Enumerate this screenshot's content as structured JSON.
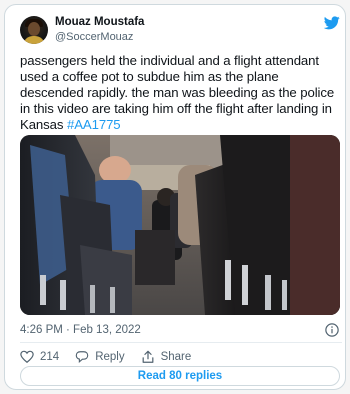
{
  "tweet": {
    "display_name": "Mouaz Moustafa",
    "handle": "@SoccerMouaz",
    "text_main": "passengers held the individual and a flight attendant used a coffee pot to subdue him as the plane descended rapidly. the man was bleeding as the police in this video are taking him off the flight after landing in Kansas",
    "hashtag": "#AA1775",
    "timestamp": "4:26 PM · Feb 13, 2022",
    "likes": "214",
    "reply_label": "Reply",
    "share_label": "Share",
    "read_replies_label": "Read 80 replies"
  },
  "icons": {
    "brand": "twitter-bird-icon",
    "info": "info-icon",
    "like": "heart-icon",
    "reply": "speech-bubble-icon",
    "share": "share-arrow-icon"
  },
  "colors": {
    "accent": "#1d9bf0",
    "text": "#0f1419",
    "muted": "#536471",
    "border": "#cfd9de"
  }
}
